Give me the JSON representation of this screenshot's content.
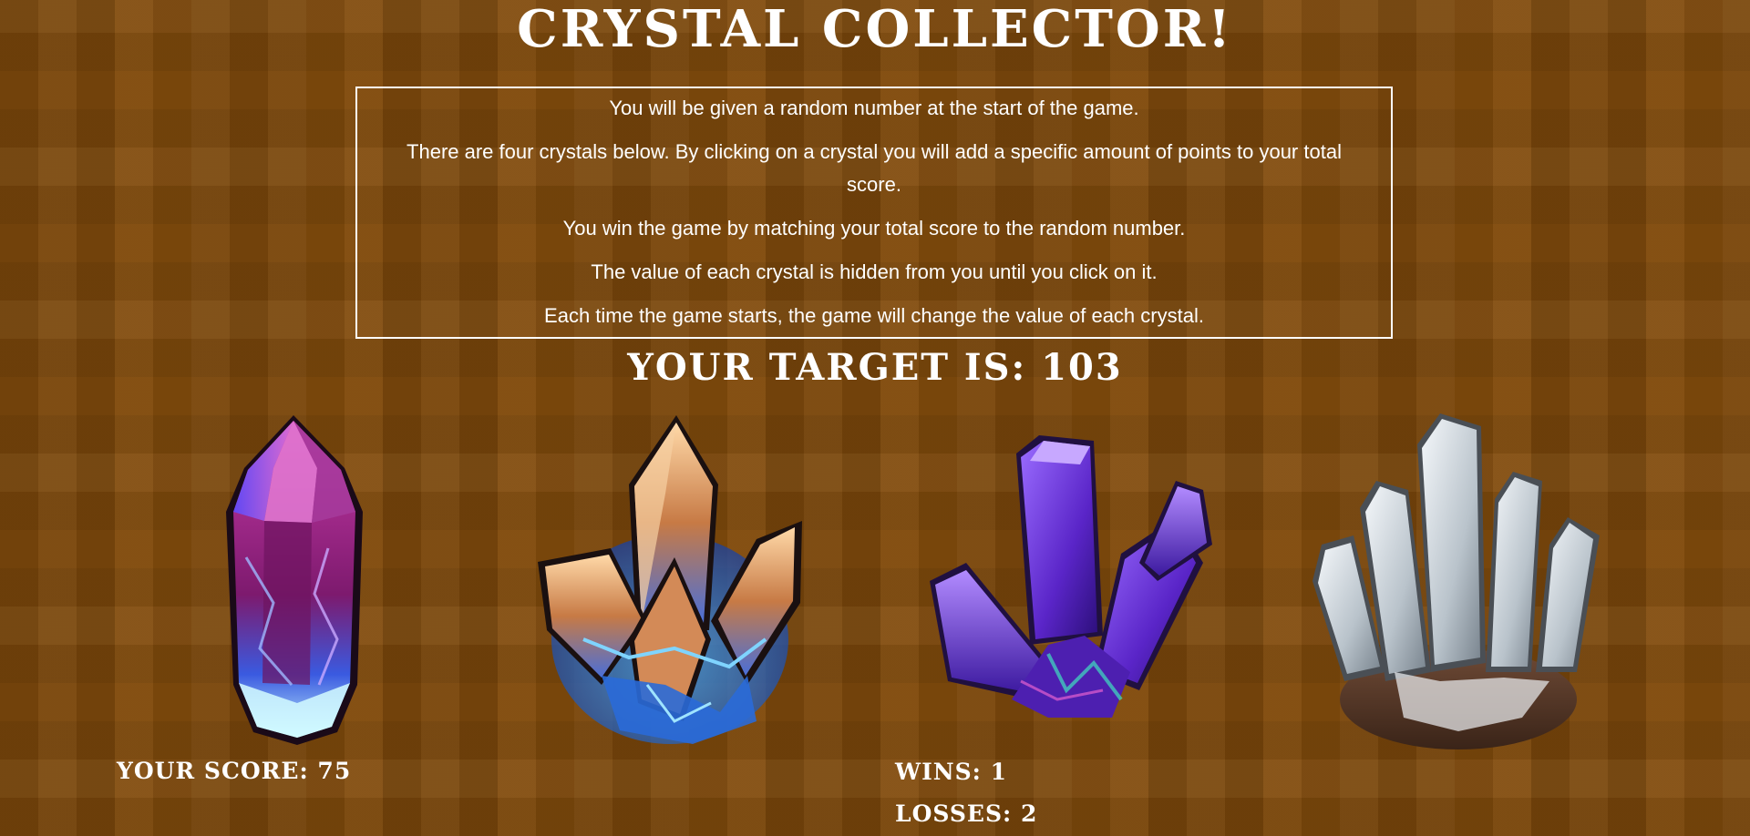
{
  "title": "CRYSTAL COLLECTOR!",
  "instructions": [
    "You will be given a random number at the start of the game.",
    "There are four crystals below. By clicking on a crystal you will add a specific amount of points to your total score.",
    "You win the game by matching your total score to the random number.",
    "The value of each crystal is hidden from you until you click on it.",
    "Each time the game starts, the game will change the value of each crystal."
  ],
  "target": {
    "label": "YOUR TARGET IS:",
    "value": "103"
  },
  "crystals": [
    {
      "name": "pink-blue crystal",
      "icon": "pink-crystal-icon"
    },
    {
      "name": "amber-blue crystal cluster",
      "icon": "amber-crystal-icon"
    },
    {
      "name": "purple crystal cluster",
      "icon": "purple-crystal-icon"
    },
    {
      "name": "white crystal cluster",
      "icon": "white-crystal-icon"
    }
  ],
  "stats": {
    "score_label": "YOUR SCORE:",
    "score": "75",
    "wins_label": "WINS:",
    "wins": "1",
    "losses_label": "LOSSES:",
    "losses": "2"
  },
  "colors": {
    "background": "#7d4504",
    "text": "#ffffff",
    "border": "#ffffff"
  }
}
